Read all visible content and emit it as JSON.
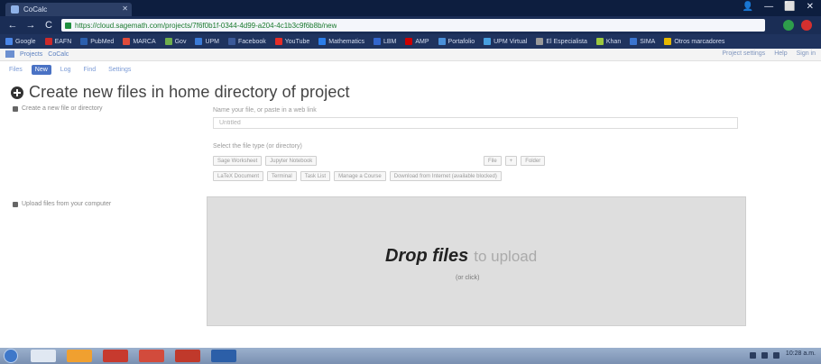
{
  "browser": {
    "tab_title": "CoCalc",
    "url": "https://cloud.sagemath.com/projects/7f6f0b1f-0344-4d99-a204-4c1b3c9f6b8b/new",
    "nav": {
      "back": "←",
      "forward": "→",
      "reload": "C",
      "home": "⌂"
    },
    "window_controls": {
      "user": "👤",
      "minimize": "—",
      "maximize": "⬜",
      "close": "✕"
    }
  },
  "bookmarks": [
    {
      "label": "Google",
      "color": "#4a86e8"
    },
    {
      "label": "EAFN",
      "color": "#cc2a2a"
    },
    {
      "label": "PubMed",
      "color": "#2b5fae"
    },
    {
      "label": "MARCA",
      "color": "#e04b3a"
    },
    {
      "label": "Gov",
      "color": "#6fae4d"
    },
    {
      "label": "UPM",
      "color": "#3b7bd8"
    },
    {
      "label": "Facebook",
      "color": "#3b5998"
    },
    {
      "label": "YouTube",
      "color": "#e52d27"
    },
    {
      "label": "Mathematics",
      "color": "#2b7de9"
    },
    {
      "label": "LBM",
      "color": "#3366cc"
    },
    {
      "label": "AMP",
      "color": "#cc0000"
    },
    {
      "label": "Portafolio",
      "color": "#4a90d9"
    },
    {
      "label": "UPM Virtual",
      "color": "#47a0e0"
    },
    {
      "label": "El Especialista",
      "color": "#999999"
    },
    {
      "label": "Khan",
      "color": "#9cc83f"
    },
    {
      "label": "SIMA",
      "color": "#3a74cf"
    },
    {
      "label": "Otros marcadores",
      "color": "#e6b800"
    }
  ],
  "appbar": {
    "projects_label": "Projects",
    "project_name": "CoCalc",
    "right_items": [
      "Project settings",
      "Help",
      "Sign in"
    ]
  },
  "subtabs": [
    "Files",
    "New",
    "Log",
    "Find",
    "Settings"
  ],
  "page": {
    "title": "Create new files in home directory of project",
    "create_section": "Create a new file or directory",
    "name_label": "Name your file, or paste in a web link",
    "name_value": "Untitled",
    "type_label": "Select the file type (or directory)",
    "buttons_row1": [
      "Sage Worksheet",
      "Jupyter Notebook"
    ],
    "buttons_row1_right": [
      "File",
      "+",
      "Folder"
    ],
    "buttons_row2": [
      "LaTeX Document",
      "Terminal",
      "Task List",
      "Manage a Course",
      "Download from Internet (available blocked)"
    ],
    "upload_section": "Upload files from your computer"
  },
  "dropzone": {
    "strong": "Drop files",
    "light": "to upload",
    "sub": "(or click)"
  },
  "taskbar": {
    "apps": [
      "#e0e8f2",
      "#f0a030",
      "#c73a2e",
      "#d24b3c",
      "#c0392b",
      "#2c5fa8"
    ],
    "clock": "10:28 a.m."
  }
}
